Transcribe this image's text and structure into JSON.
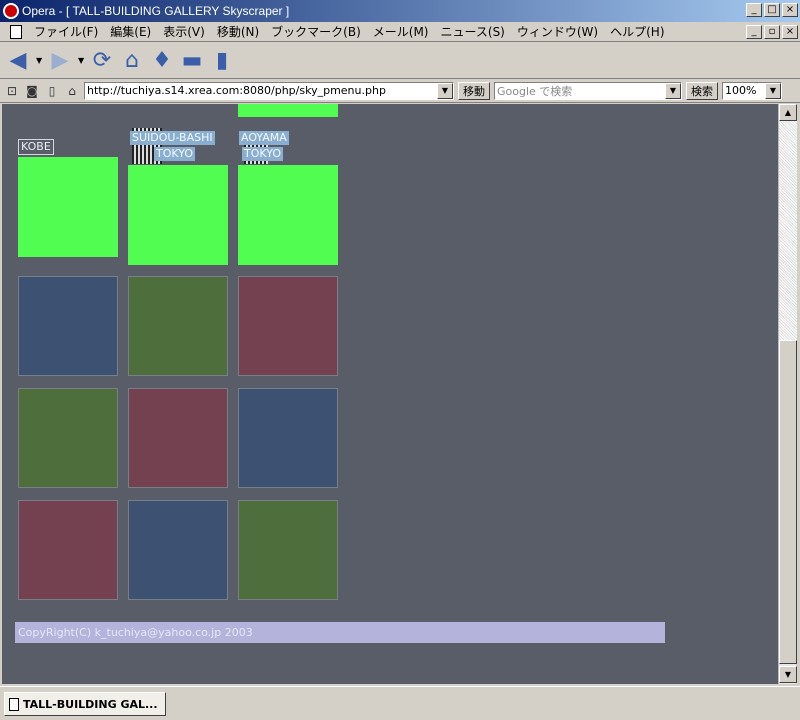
{
  "window": {
    "title": "Opera - [ TALL-BUILDING GALLERY Skyscraper ]",
    "buttons": [
      "_",
      "□",
      "×"
    ],
    "mdi_buttons": [
      "_",
      "▫",
      "×"
    ]
  },
  "menu": {
    "items": [
      "ファイル(F)",
      "編集(E)",
      "表示(V)",
      "移動(N)",
      "ブックマーク(B)",
      "メール(M)",
      "ニュース(S)",
      "ウィンドウ(W)",
      "ヘルプ(H)"
    ]
  },
  "toolbar": {
    "icons": [
      "back-icon",
      "forward-icon",
      "reload-icon",
      "home-icon",
      "hotlist-icon",
      "print-icon",
      "page-icon"
    ]
  },
  "address": {
    "url": "http://tuchiya.s14.xrea.com:8080/php/sky_pmenu.php",
    "go_label": "移動",
    "search_placeholder": "Google で検索",
    "search_label": "検索",
    "zoom": "100%"
  },
  "content": {
    "labels": {
      "kobe": "KOBE",
      "suidou_line1": "SUIDOU-BASHI",
      "suidou_line2": "TOKYO",
      "aoyama_line1": "AOYAMA",
      "aoyama_line2": "TOKYO"
    },
    "copyright": "CopyRight(C) k_tuchiya@yahoo.co.jp 2003",
    "colors": {
      "background": "#595d67",
      "bright_green": "#50fd50",
      "blue": "#3d5272",
      "green": "#4e6e3c",
      "red": "#73414f"
    }
  },
  "status": {
    "tab_title": "TALL-BUILDING GAL..."
  }
}
